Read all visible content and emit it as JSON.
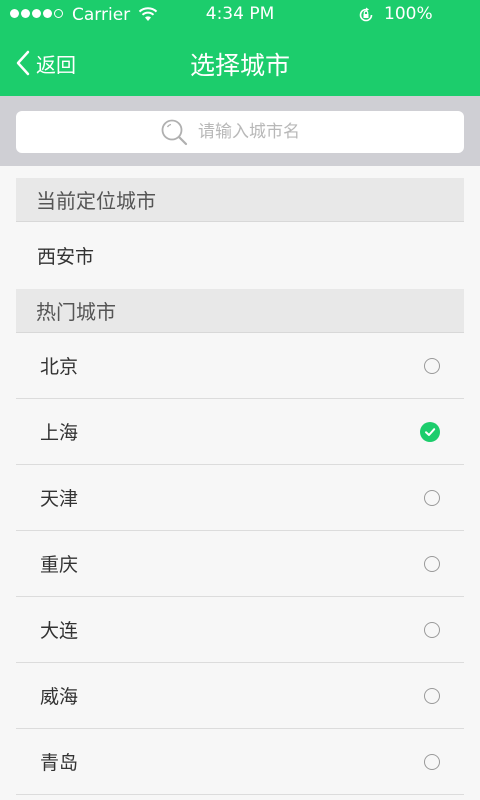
{
  "status_bar": {
    "carrier": "Carrier",
    "time": "4:34 PM",
    "battery": "100%"
  },
  "nav": {
    "back_label": "返回",
    "title": "选择城市"
  },
  "search": {
    "placeholder": "请输入城市名",
    "value": ""
  },
  "current_location": {
    "header": "当前定位城市",
    "city": "西安市"
  },
  "hot_cities": {
    "header": "热门城市",
    "items": [
      {
        "name": "北京",
        "selected": false
      },
      {
        "name": "上海",
        "selected": true
      },
      {
        "name": "天津",
        "selected": false
      },
      {
        "name": "重庆",
        "selected": false
      },
      {
        "name": "大连",
        "selected": false
      },
      {
        "name": "威海",
        "selected": false
      },
      {
        "name": "青岛",
        "selected": false
      }
    ]
  },
  "colors": {
    "accent": "#1ccd6c",
    "search_bg": "#cfcfd4",
    "section_bg": "#e8e8e8"
  }
}
